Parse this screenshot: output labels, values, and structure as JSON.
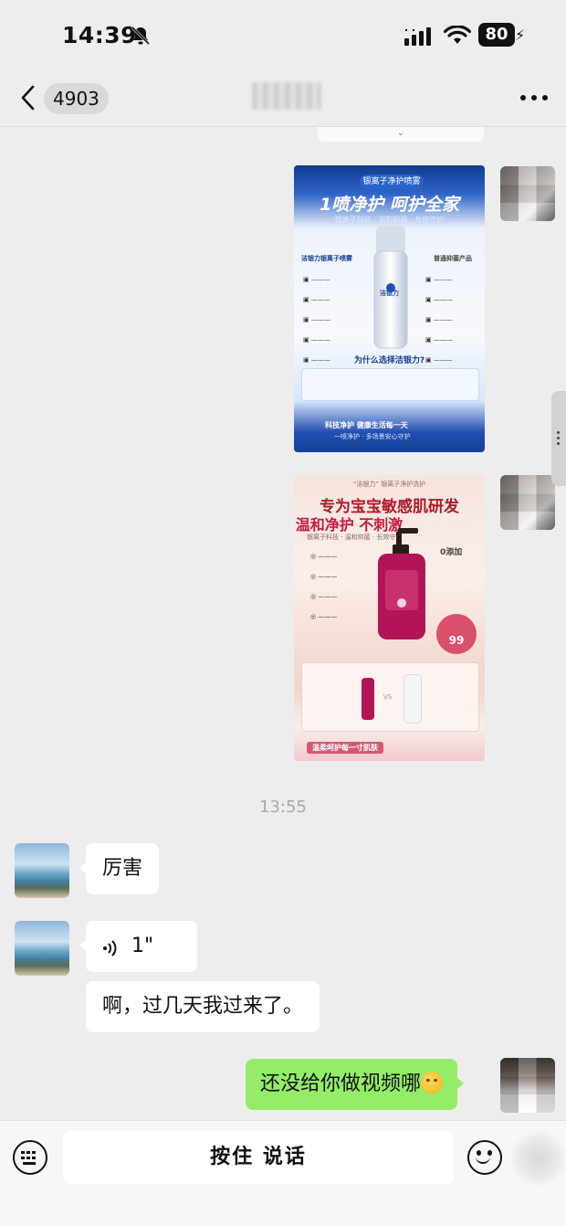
{
  "status_bar": {
    "time": "14:39",
    "battery": "80"
  },
  "header": {
    "back_count": "4903"
  },
  "divider": {
    "time": "13:55"
  },
  "poster_blue": {
    "badge": "银离子净护喷雾",
    "headline": "1喷净护 呵护全家",
    "sub": "银离子科技 · 温和抑菌 · 长效守护",
    "left_title": "洁银力银离子喷雾",
    "right_title": "普通抑菌产品",
    "brand": "洁银力",
    "question": "为什么选择洁银力?",
    "footer_a": "科技净护  健康生活每一天",
    "footer_b": "一喷净护 · 多场景安心守护"
  },
  "poster_pink": {
    "top": "“洁银力” 银离子净护洗护",
    "headline1": "专为宝宝敏感肌研发",
    "headline2": "温和净护 不刺激",
    "sub": "银离子科技 · 温和抑菌 · 长效守护",
    "zero_add": "0添加",
    "rate": "99",
    "vs": "VS",
    "footer": "温柔呵护每一寸肌肤"
  },
  "messages": {
    "m1_text": "厉害",
    "voice_duration": "1\"",
    "m3_text": "啊，过几天我过来了。",
    "m4_text": "还没给你做视频哪"
  },
  "input_bar": {
    "hold_to_talk": "按住 说话"
  }
}
